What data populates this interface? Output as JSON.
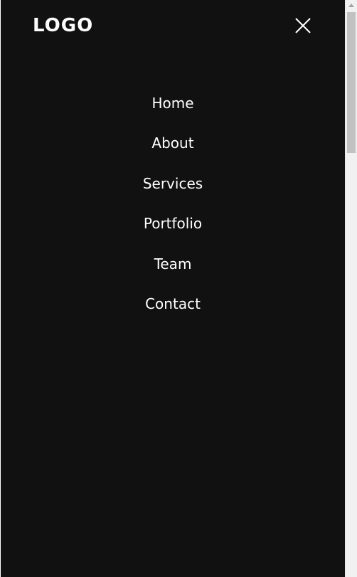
{
  "header": {
    "logo_text": "LOGO",
    "close_icon": "close-icon"
  },
  "nav": {
    "items": [
      {
        "label": "Home"
      },
      {
        "label": "About"
      },
      {
        "label": "Services"
      },
      {
        "label": "Portfolio"
      },
      {
        "label": "Team"
      },
      {
        "label": "Contact"
      }
    ]
  },
  "colors": {
    "menu_background": "#111111",
    "text": "#ffffff",
    "scrollbar_track": "#f1f1f1",
    "scrollbar_thumb": "#c1c1c1"
  }
}
